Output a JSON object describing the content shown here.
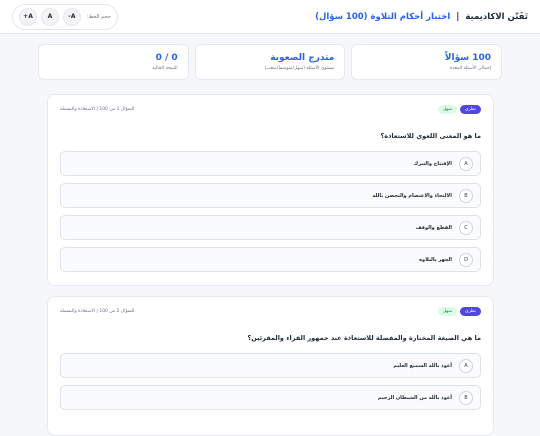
{
  "header": {
    "brand_name": "تَفَنّن الاكاديمية",
    "separator": "|",
    "subtitle": "اختبار أحكام التلاوة (100 سؤال)",
    "font_size_label": "حجم الخط:",
    "font_buttons": [
      "A-",
      "A",
      "A+"
    ]
  },
  "stats": [
    {
      "value": "100 سؤالاً",
      "label": "إجمالي الأسئلة المعدة"
    },
    {
      "value": "متدرج الصعوبة",
      "label": "مستوى الأسئلة (سهل/متوسط/صعب)"
    },
    {
      "value": "0 / 0",
      "label": "النتيجة الحالية"
    }
  ],
  "questions": [
    {
      "tags": [
        "نظري",
        "سهل"
      ],
      "meta": "السؤال 1 من 100 | الاستعاذة والبسملة",
      "text": "ما هو المعنى اللغوي للاستعاذة؟",
      "options": [
        {
          "letter": "A",
          "text": "الإفتتاح والتبرك"
        },
        {
          "letter": "B",
          "text": "الالتجاء والاعتصام والتحصن بالله"
        },
        {
          "letter": "C",
          "text": "القطع والوقف"
        },
        {
          "letter": "D",
          "text": "الجهر بالتلاوة"
        }
      ]
    },
    {
      "tags": [
        "نظري",
        "سهل"
      ],
      "meta": "السؤال 2 من 100 | الاستعاذة والبسملة",
      "text": "ما هي الصيغة المختارة والمفضلة للاستعاذة عند جمهور القراء والمقرئين؟",
      "options": [
        {
          "letter": "A",
          "text": "أعوذ بالله السميع العليم"
        },
        {
          "letter": "B",
          "text": "أعوذ بالله من الشيطان الرجيم"
        }
      ]
    }
  ]
}
